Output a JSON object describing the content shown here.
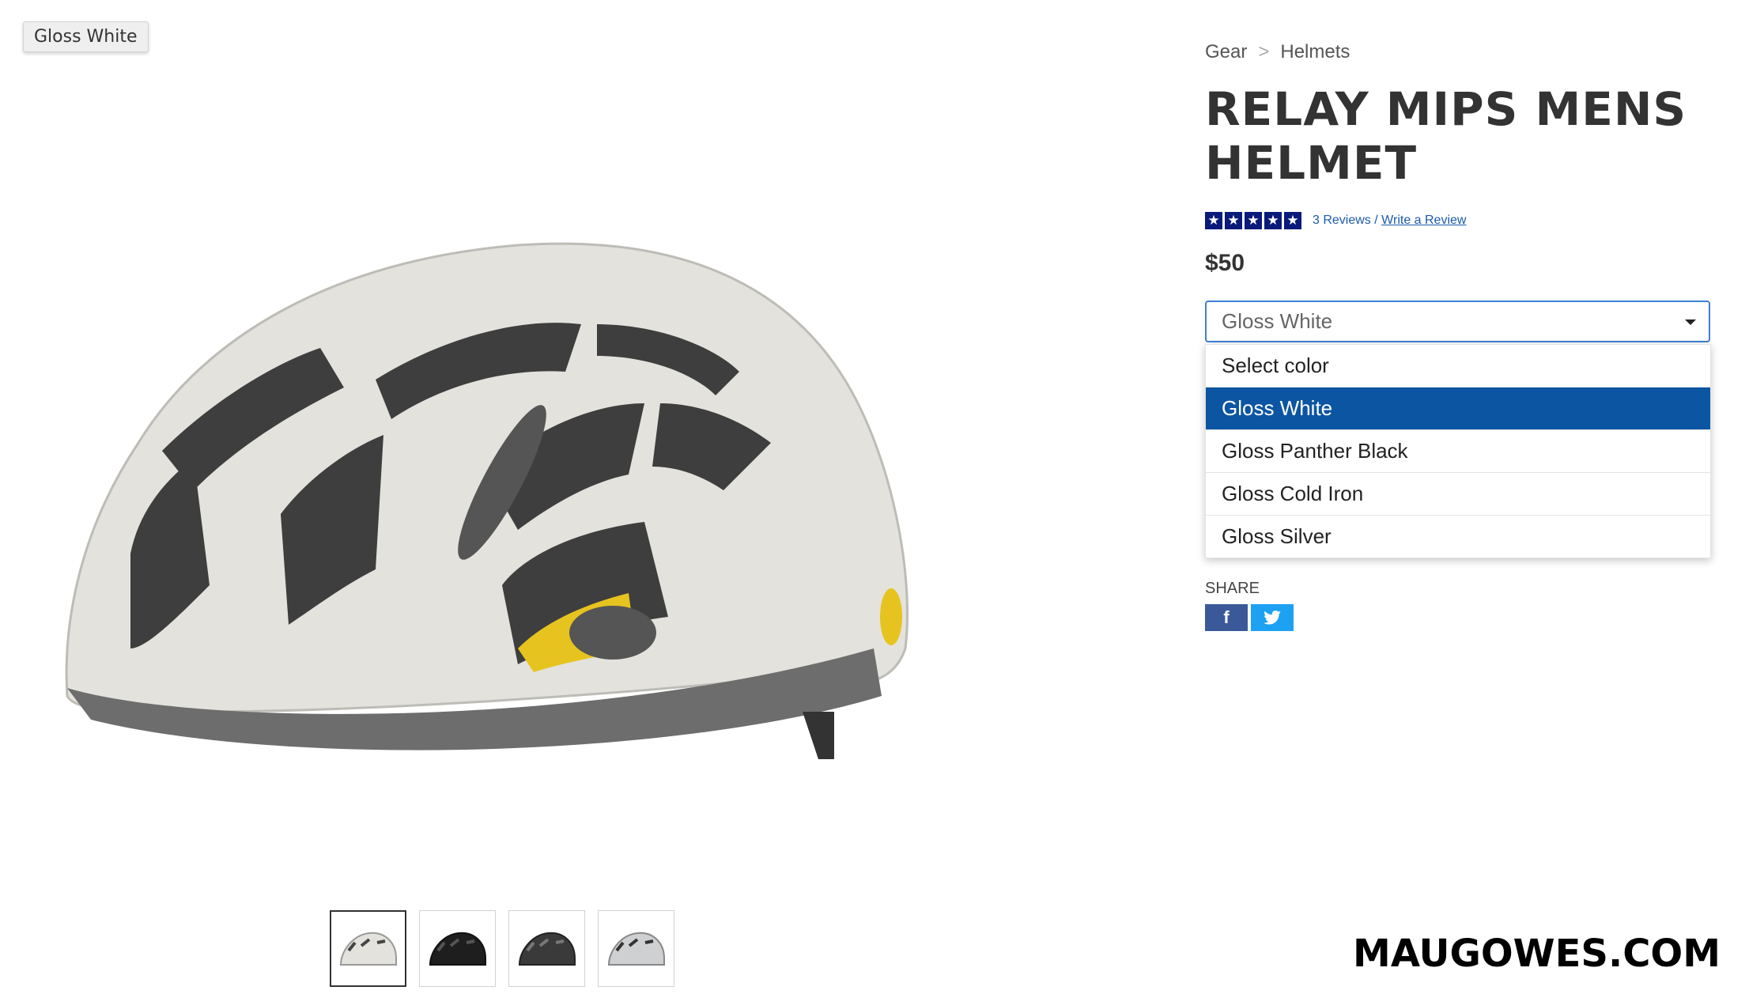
{
  "tooltip": {
    "text": "Gloss White"
  },
  "breadcrumb": {
    "items": [
      "Gear",
      "Helmets"
    ],
    "separator": ">"
  },
  "product": {
    "title": "RELAY MIPS MENS HELMET",
    "rating": 5,
    "reviews_count_label": "3 Reviews",
    "review_sep": "/",
    "write_review_label": "Write a Review",
    "price": "$50"
  },
  "color_select": {
    "selected": "Gloss White",
    "options": [
      "Select color",
      "Gloss White",
      "Gloss Panther Black",
      "Gloss Cold Iron",
      "Gloss Silver"
    ],
    "highlighted_index": 1
  },
  "share": {
    "label": "SHARE",
    "facebook_icon": "f",
    "twitter_icon": "t"
  },
  "thumbnails": [
    "white",
    "black",
    "cold-iron",
    "silver"
  ],
  "watermark": "MAUGOWES.COM",
  "colors": {
    "accent": "#0b55a3",
    "star": "#0a1a7a",
    "facebook": "#3b5998",
    "twitter": "#1da1f2"
  }
}
